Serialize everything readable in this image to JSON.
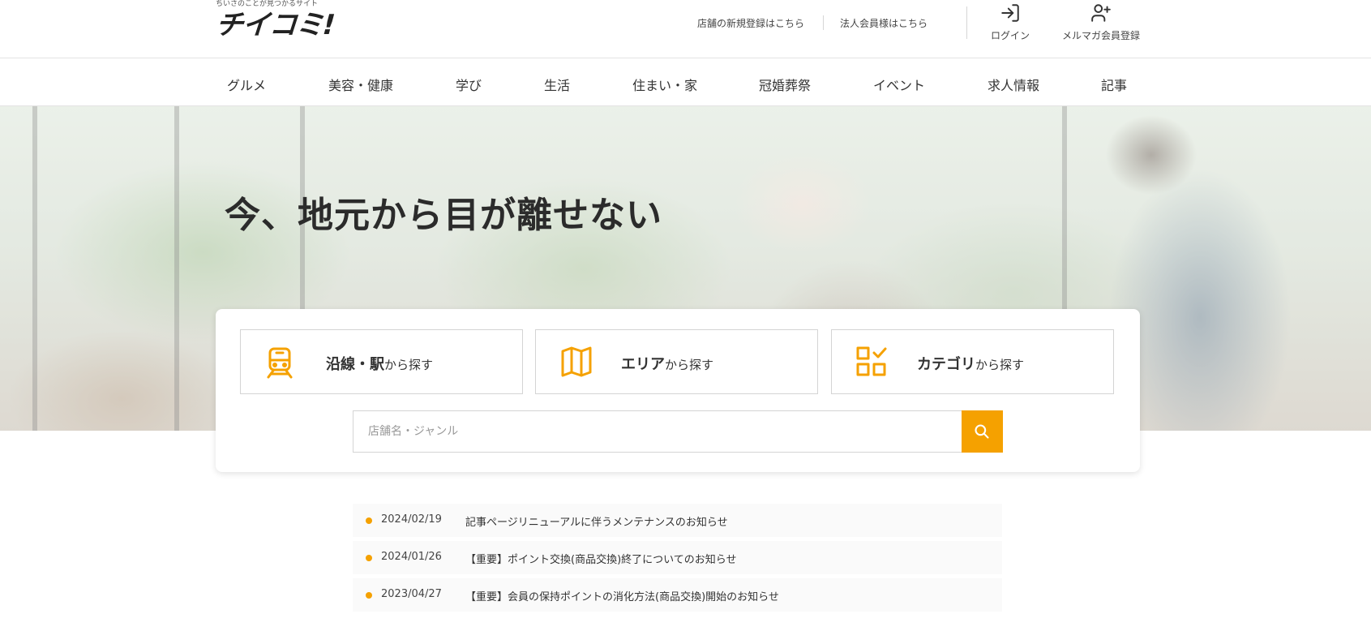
{
  "site": {
    "tagline": "ちいさのことが見つかるサイト",
    "logo": "チイコミ!"
  },
  "header": {
    "links": [
      {
        "label": "店舗の新規登録はこちら"
      },
      {
        "label": "法人会員様はこちら"
      }
    ],
    "login_label": "ログイン",
    "register_label": "メルマガ会員登録"
  },
  "nav": {
    "items": [
      {
        "label": "グルメ"
      },
      {
        "label": "美容・健康"
      },
      {
        "label": "学び"
      },
      {
        "label": "生活"
      },
      {
        "label": "住まい・家"
      },
      {
        "label": "冠婚葬祭"
      },
      {
        "label": "イベント"
      },
      {
        "label": "求人情報"
      },
      {
        "label": "記事"
      }
    ]
  },
  "hero": {
    "title": "今、地元から目が離せない"
  },
  "search": {
    "categories": [
      {
        "strong": "沿線・駅",
        "rest": "から探す",
        "icon": "train-icon"
      },
      {
        "strong": "エリア",
        "rest": "から探す",
        "icon": "map-icon"
      },
      {
        "strong": "カテゴリ",
        "rest": "から探す",
        "icon": "category-grid-icon"
      }
    ],
    "placeholder": "店舗名・ジャンル",
    "button_icon": "search-icon"
  },
  "news": {
    "items": [
      {
        "date": "2024/02/19",
        "title": "記事ページリニューアルに伴うメンテナンスのお知らせ"
      },
      {
        "date": "2024/01/26",
        "title": "【重要】ポイント交換(商品交換)終了についてのお知らせ"
      },
      {
        "date": "2023/04/27",
        "title": "【重要】会員の保持ポイントの消化方法(商品交換)開始のお知らせ"
      }
    ]
  },
  "colors": {
    "accent": "#f5a100",
    "text": "#333333"
  }
}
